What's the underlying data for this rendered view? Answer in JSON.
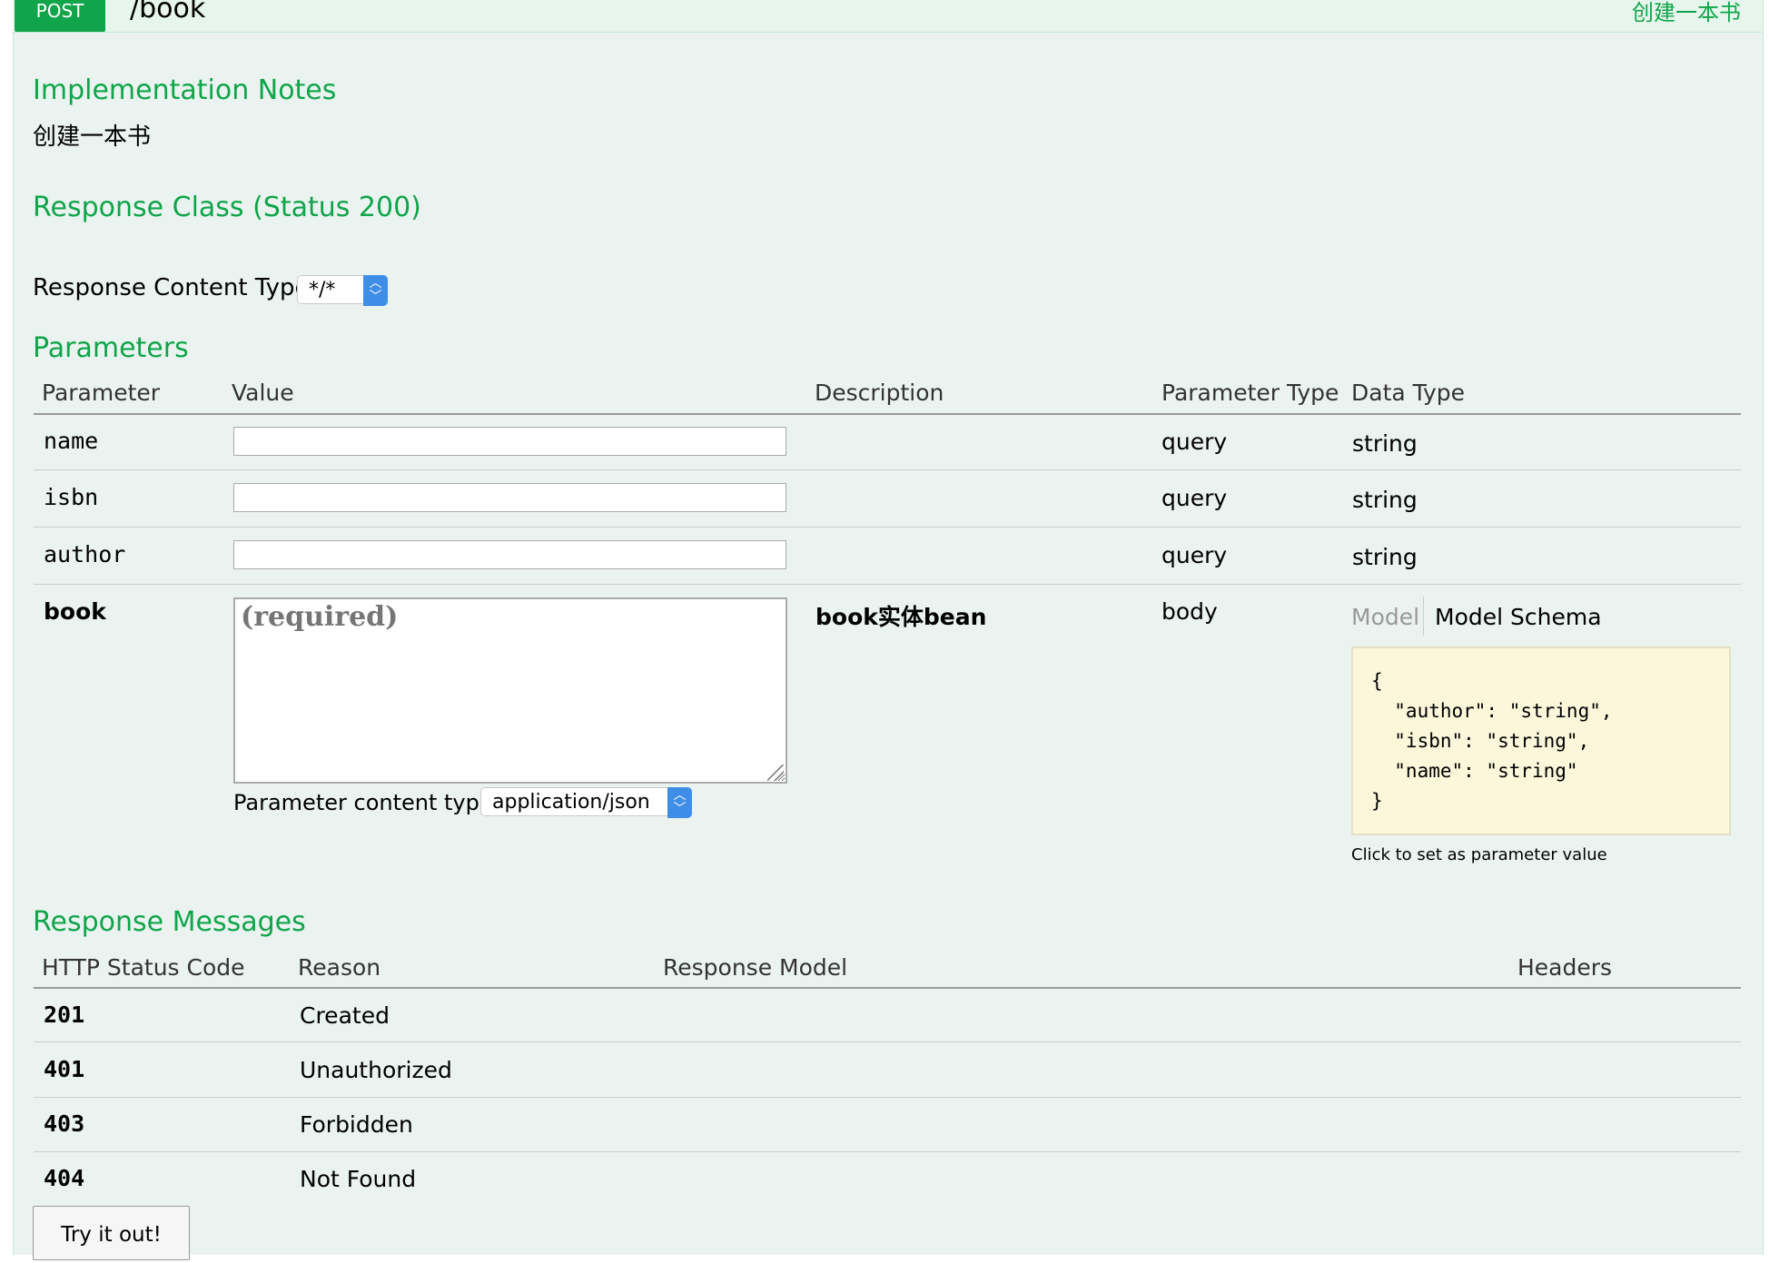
{
  "operation": {
    "method": "POST",
    "path": "/book",
    "summary": "创建一本书"
  },
  "implementation_notes": {
    "heading": "Implementation Notes",
    "text": "创建一本书"
  },
  "response_class": {
    "heading": "Response Class (Status 200)",
    "content_type_label": "Response Content Type",
    "content_type_value": "*/*"
  },
  "parameters": {
    "heading": "Parameters",
    "columns": [
      "Parameter",
      "Value",
      "Description",
      "Parameter Type",
      "Data Type"
    ],
    "rows": [
      {
        "name": "name",
        "value": "",
        "description": "",
        "param_type": "query",
        "data_type": "string"
      },
      {
        "name": "isbn",
        "value": "",
        "description": "",
        "param_type": "query",
        "data_type": "string"
      },
      {
        "name": "author",
        "value": "",
        "description": "",
        "param_type": "query",
        "data_type": "string"
      },
      {
        "name": "book",
        "value": "",
        "placeholder": "(required)",
        "description": "book实体bean",
        "param_type": "body"
      }
    ],
    "content_type_label": "Parameter content type:",
    "content_type_value": "application/json",
    "model_tab": "Model",
    "model_schema_tab": "Model Schema",
    "schema_text": "{\n  \"author\": \"string\",\n  \"isbn\": \"string\",\n  \"name\": \"string\"\n}",
    "schema_hint": "Click to set as parameter value"
  },
  "response_messages": {
    "heading": "Response Messages",
    "columns": [
      "HTTP Status Code",
      "Reason",
      "Response Model",
      "Headers"
    ],
    "rows": [
      {
        "code": "201",
        "reason": "Created"
      },
      {
        "code": "401",
        "reason": "Unauthorized"
      },
      {
        "code": "403",
        "reason": "Forbidden"
      },
      {
        "code": "404",
        "reason": "Not Found"
      }
    ]
  },
  "try_button": "Try it out!",
  "colors": {
    "accent": "#10a54a",
    "panel_background": "#ebf3f0",
    "select_arrow": "#3e8ee8",
    "schema_background": "#fcf6db"
  }
}
